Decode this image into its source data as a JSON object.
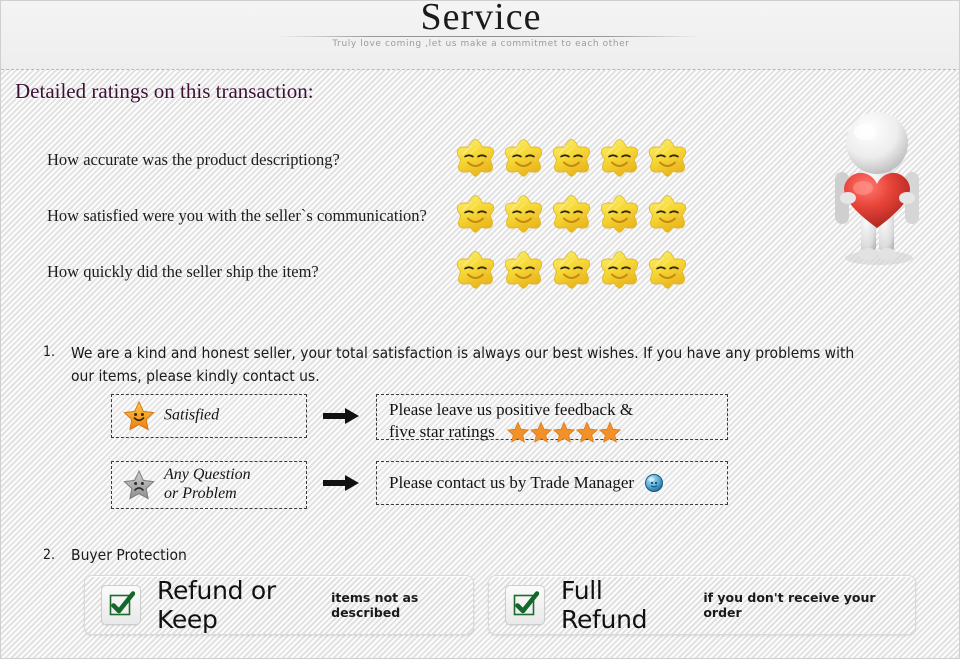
{
  "header": {
    "title": "Service",
    "subtitle": "Truly love coming ,let us make a commitmet to each other"
  },
  "ratings": {
    "section_title": "Detailed ratings on this transaction:",
    "star_count": 5,
    "rows": [
      {
        "question": "How accurate was the product descriptiong?",
        "stars": 5
      },
      {
        "question": "How satisfied were you with the seller`s communication?",
        "stars": 5
      },
      {
        "question": "How quickly did the seller ship the item?",
        "stars": 5
      }
    ]
  },
  "notes": {
    "item1_number": "1.",
    "item1_text": "We are a kind and honest seller, your total satisfaction is always our best wishes. If you have any problems with our items, please kindly contact us.",
    "item2_number": "2.",
    "item2_text": "Buyer Protection"
  },
  "flow": {
    "row1": {
      "left_icon": "happy-star-icon",
      "left_label": "Satisfied",
      "arrow": "arrow-right-icon",
      "right_line1": "Please leave us positive feedback &",
      "right_line2": "five star ratings",
      "right_stars": 5
    },
    "row2": {
      "left_icon": "sad-star-icon",
      "left_label_line1": "Any Question",
      "left_label_line2": "or Problem",
      "arrow": "arrow-right-icon",
      "right_text": "Please contact us by Trade Manager",
      "right_icon": "trade-manager-icon"
    }
  },
  "protection": {
    "panels": [
      {
        "icon": "green-check-icon",
        "title": "Refund or Keep",
        "subtitle": "items not as described"
      },
      {
        "icon": "green-check-icon",
        "title": "Full Refund",
        "subtitle": "if you don't receive your order"
      }
    ]
  },
  "decor": {
    "mascot": "person-holding-heart-icon"
  },
  "colors": {
    "heading": "#3d1136",
    "star_gold": "#f2d23a",
    "star_orange": "#f0932b",
    "star_gray": "#9e9e9e",
    "check_green": "#1b6b2e",
    "heart_red": "#e23b33",
    "background": "#efefef"
  }
}
